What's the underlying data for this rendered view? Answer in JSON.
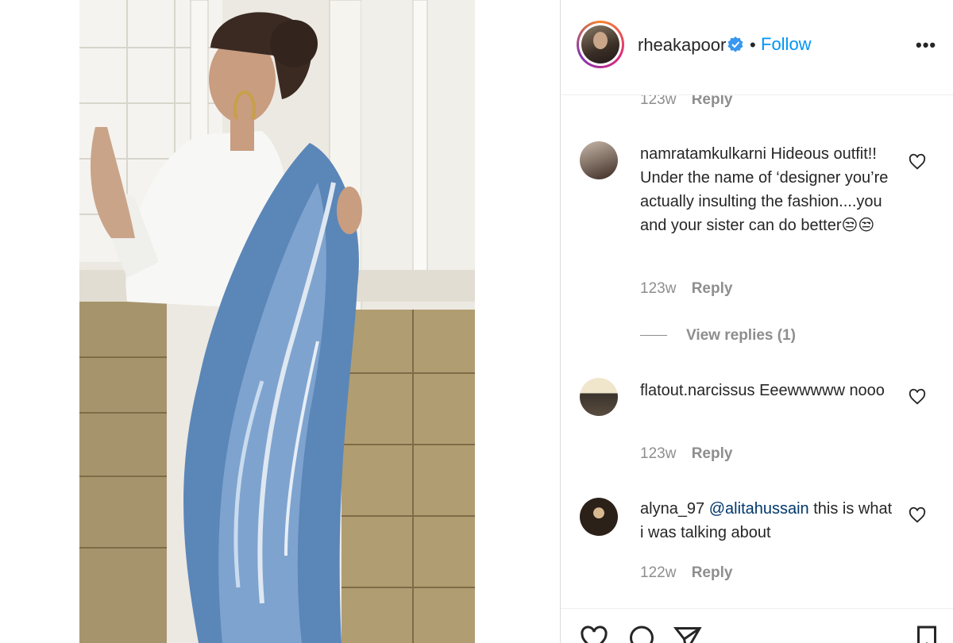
{
  "post": {
    "image_alt_icon": "photo-woman-in-blue-saree"
  },
  "header": {
    "username": "rheakapoor",
    "separator": "•",
    "follow_label": "Follow",
    "more_label": "•••",
    "verified_icon": "verified-badge-icon"
  },
  "comments": {
    "partial_meta": {
      "time": "123w",
      "reply_label": "Reply"
    },
    "items": [
      {
        "username": "namratamkulkarni",
        "text": "Hideous outfit!! Under the name of ‘designer you’re actually insulting the fashion....you and your sister can do better😒😒",
        "time": "123w",
        "reply_label": "Reply",
        "view_replies_label": "View replies (1)"
      },
      {
        "username": "flatout.narcissus",
        "text": "Eeewwwww nooo",
        "time": "123w",
        "reply_label": "Reply"
      },
      {
        "username": "alyna_97",
        "mention": "@alitahussain",
        "text": "this is what i was talking about",
        "time": "122w",
        "reply_label": "Reply"
      }
    ],
    "truncation_glyph": "..."
  },
  "actions": {
    "icons": [
      "heart-icon",
      "comment-icon",
      "share-icon",
      "bookmark-icon"
    ]
  },
  "colors": {
    "follow_blue": "#0095f6",
    "verified_blue": "#3897f0",
    "meta_gray": "#8e8e8e",
    "text_dark": "#262626",
    "mention_blue": "#00376b"
  }
}
